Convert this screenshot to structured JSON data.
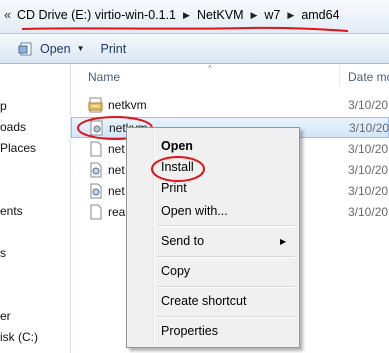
{
  "address": {
    "prefix": "«",
    "crumbs": [
      "CD Drive (E:) virtio-win-0.1.1",
      "NetKVM",
      "w7",
      "amd64"
    ],
    "separator": "▶"
  },
  "toolbar": {
    "open_label": "Open",
    "open_chevron": "▼",
    "print_label": "Print"
  },
  "nav": {
    "items": [
      "p",
      "oads",
      "Places",
      "ents",
      "s",
      "er",
      "isk (C:)"
    ]
  },
  "columns": {
    "name": "Name",
    "sort_indicator": "^",
    "date": "Date mo"
  },
  "files": [
    {
      "name": "netkvm",
      "date": "3/10/20",
      "icon": "setup-info-icon"
    },
    {
      "name": "netkvm",
      "date": "3/10/20",
      "icon": "system-file-icon"
    },
    {
      "name": "net",
      "date": "3/10/20",
      "icon": "document-icon"
    },
    {
      "name": "net",
      "date": "3/10/20",
      "icon": "gear-file-icon"
    },
    {
      "name": "net",
      "date": "3/10/20",
      "icon": "gear-file-icon"
    },
    {
      "name": "rea",
      "date": "3/10/20",
      "icon": "document-icon"
    }
  ],
  "context_menu": {
    "open": "Open",
    "install": "Install",
    "print": "Print",
    "open_with": "Open with...",
    "send_to": "Send to",
    "submenu_arrow": "▶",
    "copy": "Copy",
    "create_shortcut": "Create shortcut",
    "properties": "Properties"
  },
  "colors": {
    "annotation_red": "#e0131a",
    "selection": "#d3e5fa"
  }
}
